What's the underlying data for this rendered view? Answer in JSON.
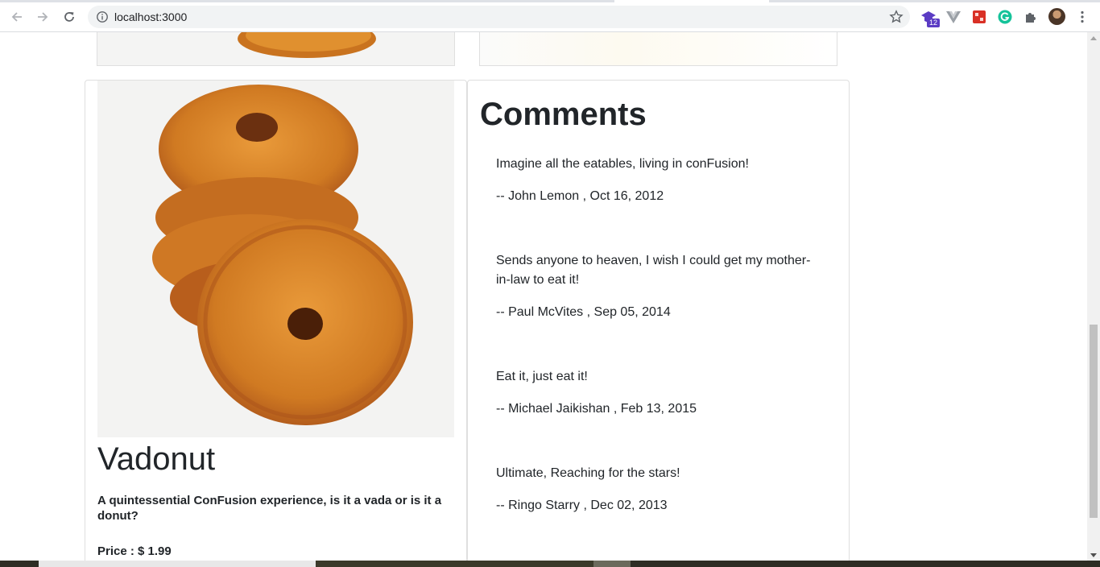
{
  "browser": {
    "url": "localhost:3000",
    "extension_badge": "12"
  },
  "dish": {
    "name": "Vadonut",
    "description": "A quintessential ConFusion experience, is it a vada or is it a donut?",
    "price": "Price : $ 1.99"
  },
  "comments": {
    "heading": "Comments",
    "items": [
      {
        "text": "Imagine all the eatables, living in conFusion!",
        "author": "-- John Lemon , Oct 16, 2012"
      },
      {
        "text": "Sends anyone to heaven, I wish I could get my mother-in-law to eat it!",
        "author": "-- Paul McVites , Sep 05, 2014"
      },
      {
        "text": "Eat it, just eat it!",
        "author": "-- Michael Jaikishan , Feb 13, 2015"
      },
      {
        "text": "Ultimate, Reaching for the stars!",
        "author": "-- Ringo Starry , Dec 02, 2013"
      }
    ]
  },
  "colors": {
    "accent": "#5b3cc4",
    "donut": "#d9822b",
    "text": "#212529"
  }
}
